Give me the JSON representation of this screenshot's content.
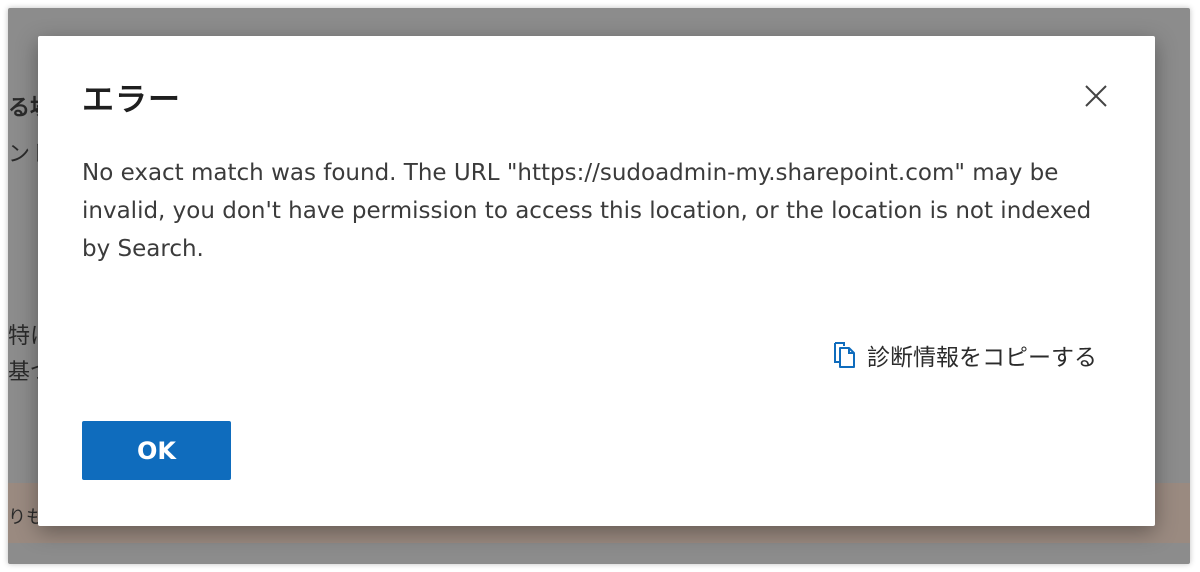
{
  "background": {
    "fragments": [
      "る場",
      "ント",
      "特に",
      "基づ",
      "りも"
    ]
  },
  "dialog": {
    "title": "エラー",
    "message": "No exact match was found. The URL \"https://sudoadmin-my.sharepoint.com\" may be invalid, you don't have permission to access this location, or the location is not indexed by Search.",
    "copy_diagnostics_label": "診断情報をコピーする",
    "ok_label": "OK",
    "close_icon": "close-icon",
    "copy_icon": "copy-icon"
  },
  "colors": {
    "primary": "#0f6cbd",
    "overlay": "#8c8c8c"
  }
}
